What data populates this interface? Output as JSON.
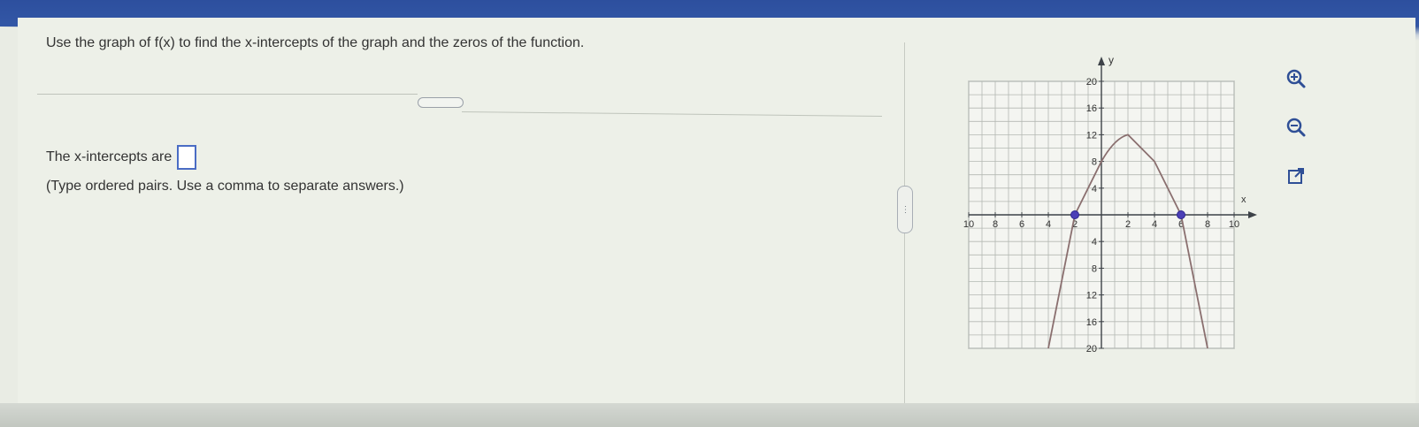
{
  "question": {
    "text": "Use the graph of f(x) to find the x-intercepts of the graph and the zeros of the function."
  },
  "answer": {
    "prefix": "The x-intercepts are",
    "value": "",
    "hint": "(Type ordered pairs. Use a comma to separate answers.)"
  },
  "tools": {
    "zoom_in_icon": "zoom-in-icon",
    "zoom_out_icon": "zoom-out-icon",
    "popout_icon": "popout-icon"
  },
  "colors": {
    "accent": "#4a6cc4",
    "curve": "#8a6f6f",
    "point": "#4b3fb7",
    "topbar": "#3357a6"
  },
  "chart_data": {
    "type": "line",
    "xlabel": "x",
    "ylabel": "y",
    "xlim": [
      -10,
      10
    ],
    "ylim": [
      -20,
      20
    ],
    "x_ticks": [
      -10,
      -8,
      -6,
      -4,
      -2,
      2,
      4,
      6,
      8,
      10
    ],
    "y_ticks": [
      -20,
      -16,
      -12,
      -8,
      -4,
      4,
      8,
      12,
      16,
      20
    ],
    "x_tick_labels": [
      "10",
      "8",
      "6",
      "4",
      "2",
      "2",
      "4",
      "6",
      "8",
      "10"
    ],
    "y_tick_labels": [
      "20",
      "16",
      "12",
      "8",
      "4",
      "4",
      "8",
      "12",
      "16",
      "20"
    ],
    "grid": true,
    "series": [
      {
        "values": [
          [
            -4,
            -20
          ],
          [
            -2,
            0
          ],
          [
            0,
            8
          ],
          [
            2,
            12
          ],
          [
            4,
            8
          ],
          [
            6,
            0
          ],
          [
            8,
            -20
          ]
        ]
      }
    ],
    "points": [
      [
        -2,
        0
      ],
      [
        6,
        0
      ]
    ]
  }
}
